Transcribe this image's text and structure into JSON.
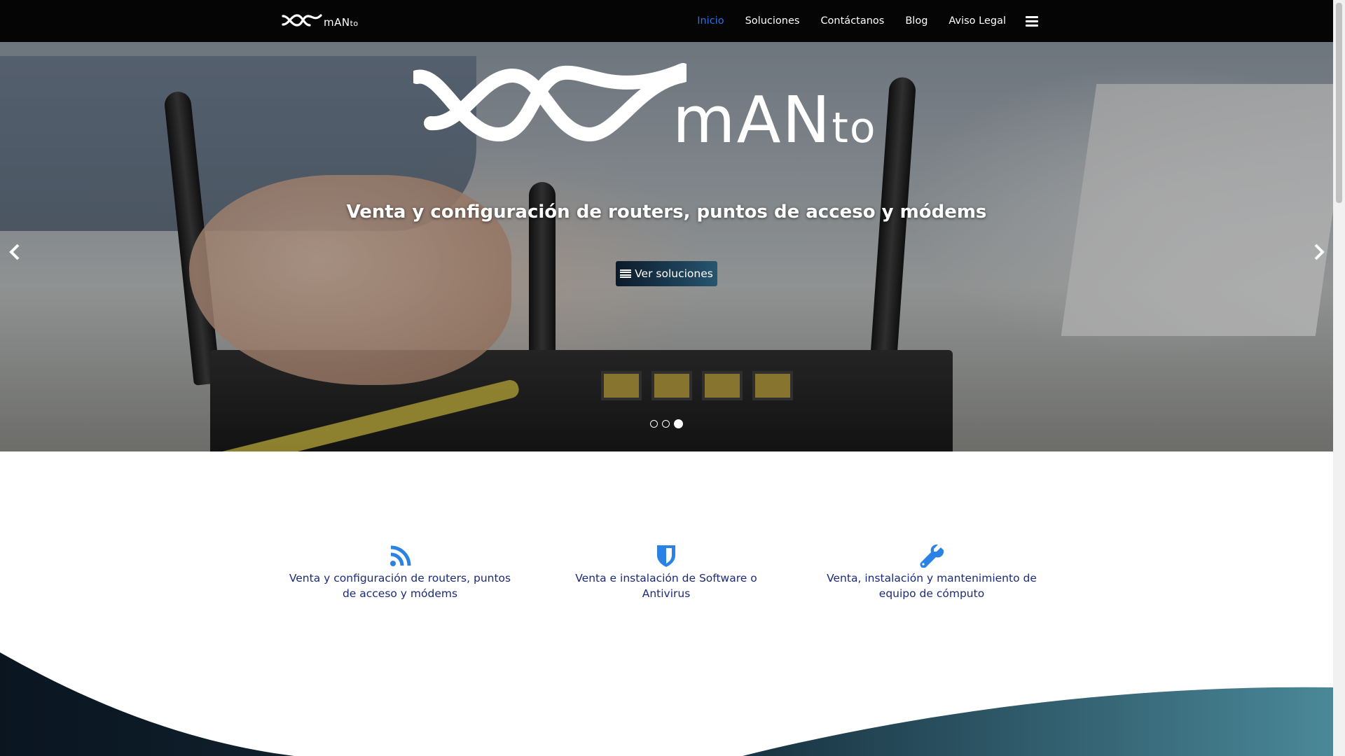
{
  "brand": {
    "name_main": "mAN",
    "name_small": "to"
  },
  "nav": {
    "items": [
      {
        "label": "Inicio",
        "active": true
      },
      {
        "label": "Soluciones"
      },
      {
        "label": "Contáctanos"
      },
      {
        "label": "Blog"
      },
      {
        "label": "Aviso Legal"
      }
    ],
    "menu_icon": "hamburger-icon"
  },
  "hero": {
    "caption": "Venta y configuración de routers, puntos de acceso y módems",
    "button_label": "Ver soluciones",
    "button_icon": "list-icon",
    "prev_icon": "chevron-left-icon",
    "next_icon": "chevron-right-icon",
    "slides_total": 3,
    "slide_active": 3
  },
  "features": [
    {
      "icon": "rss-icon",
      "text": "Venta y configuración de routers, puntos de acceso y módems"
    },
    {
      "icon": "shield-icon",
      "text": "Venta e instalación de Software o Antivirus"
    },
    {
      "icon": "wrench-icon",
      "text": "Venta, instalación y mantenimiento de equipo de cómputo"
    }
  ],
  "colors": {
    "nav_bg": "#050505",
    "nav_active": "#2f6fdc",
    "feature_icon": "#2a82e4",
    "feature_text": "#1c2a7a",
    "wave_dark": "#0a1520",
    "wave_teal": "#4a8898"
  }
}
